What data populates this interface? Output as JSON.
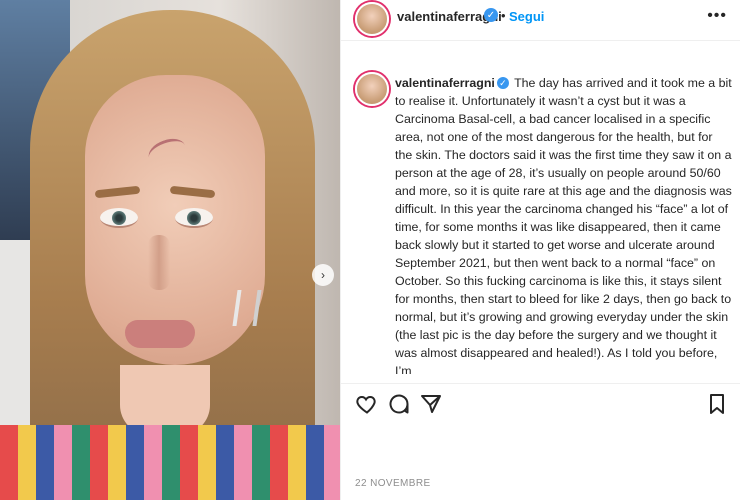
{
  "post": {
    "username": "valentinaferragni",
    "follow_label": "Segui",
    "separator": "•",
    "more_label": "•••",
    "caption_text": "The day has arrived and it took me a bit to realise it. Unfortunately it wasn’t a cyst but it was a Carcinoma Basal-cell, a bad cancer localised in a specific area, not one of the most dangerous for the health, but for the skin. The doctors said it was the first time they saw it on a person at the age of 28, it’s usually on people around 50/60 and more, so it is quite rare at this age and the diagnosis was difficult. In this year the carcinoma changed his “face” a lot of time, for some months it was like disappeared, then it came back slowly but it started to get worse and ulcerate around September 2021, but then went back to a normal “face” on October. So this fucking carcinoma is like this, it stays silent for months, then start to bleed for like 2 days, then go back to normal, but it’s growing and growing everyday under the skin (the last pic is the day before the surgery and we thought it was almost disappeared and healed!). As I told you before, I’m",
    "date": "22 NOVEMBRE"
  },
  "icons": {
    "verified": "verified-badge-icon",
    "carousel_next": "chevron-right-icon",
    "like": "heart-icon",
    "comment": "comment-icon",
    "share": "paper-plane-icon",
    "save": "bookmark-icon"
  },
  "colors": {
    "link_blue": "#0095f6",
    "verified_blue": "#3897f0",
    "text": "#262626",
    "muted": "#8e8e8e"
  }
}
